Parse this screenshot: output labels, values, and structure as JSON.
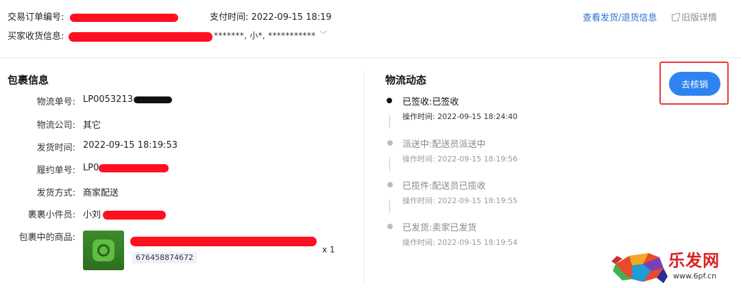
{
  "header": {
    "order_no_label": "交易订单编号:",
    "pay_time_label": "支付时间:",
    "pay_time_value": "2022-09-15 18:19",
    "buyer_label": "买家收货信息:",
    "buyer_masked_tail": "*******, 小*, ***********",
    "link_logistics": "查看发货/退货信息",
    "link_old_detail": "旧版详情"
  },
  "package": {
    "title": "包裹信息",
    "fields": [
      {
        "label": "物流单号:",
        "value": "LP0053213"
      },
      {
        "label": "物流公司:",
        "value": "其它"
      },
      {
        "label": "发货时间:",
        "value": "2022-09-15 18:19:53"
      },
      {
        "label": "履约单号:",
        "value": "LP0"
      },
      {
        "label": "发货方式:",
        "value": "商家配送"
      },
      {
        "label": "裹裹小件员:",
        "value": "小刘"
      }
    ],
    "goods_label": "包裹中的商品:",
    "sku": "676458874672",
    "qty": "x 1"
  },
  "logistics": {
    "title": "物流动态",
    "time_prefix": "操作时间:",
    "events": [
      {
        "status": "已签收:已签收",
        "time": "操作时间: 2022-09-15 18:24:40",
        "active": true
      },
      {
        "status": "派送中:配送员派送中",
        "time": "操作时间: 2022-09-15 18:19:56",
        "active": false
      },
      {
        "status": "已揽件:配送员已揽收",
        "time": "操作时间: 2022-09-15 18:19:55",
        "active": false
      },
      {
        "status": "已发货:卖家已发货",
        "time": "操作时间: 2022-09-15 18:19:54",
        "active": false
      }
    ]
  },
  "actions": {
    "writeoff": "去核销"
  },
  "watermark": {
    "text": "乐发网",
    "url": "www.6pf.cn"
  },
  "colors": {
    "accent": "#2f83f0",
    "link": "#2a6fd6",
    "redaction": "#ff1020",
    "highlight_box": "#ee3333"
  }
}
